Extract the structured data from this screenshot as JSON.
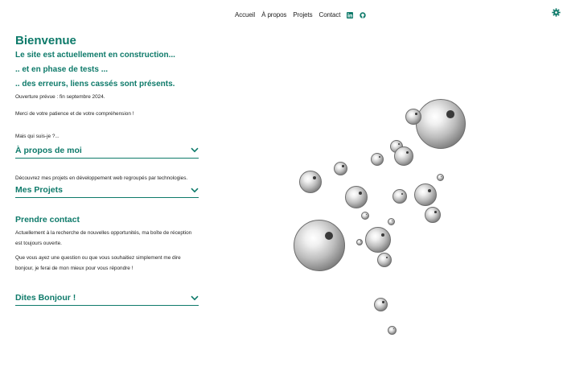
{
  "nav": {
    "items": [
      "Accueil",
      "À propos",
      "Projets",
      "Contact"
    ],
    "icons": [
      "linkedin-icon",
      "github-icon"
    ]
  },
  "settings": {
    "icon": "gear-icon"
  },
  "intro": {
    "title": "Bienvenue",
    "line1": "Le site est actuellement en construction...",
    "line2": ".. et en phase de tests ...",
    "line3": ".. des erreurs, liens cassés sont présents.",
    "opening": "Ouverture prévue : fin septembre 2024.",
    "thanks": "Merci de votre patience et de votre compréhension !",
    "who": "Mais qui suis-je ?..."
  },
  "about": {
    "label": "À propos de moi"
  },
  "projects": {
    "desc": "Découvrez mes projets en développement web regroupés par technologies.",
    "label": "Mes Projets"
  },
  "contact": {
    "heading": "Prendre contact",
    "p1": "Actuellement à la recherche de nouvelles opportunités, ma boîte de réception est toujours ouverte.",
    "p2": "Que vous ayez une question ou que vous souhaitiez simplement me dire bonjour, je ferai de mon mieux pour vous répondre !",
    "button": "Dites Bonjour !"
  },
  "colors": {
    "accent": "#0e7a6a",
    "text": "#222222"
  }
}
